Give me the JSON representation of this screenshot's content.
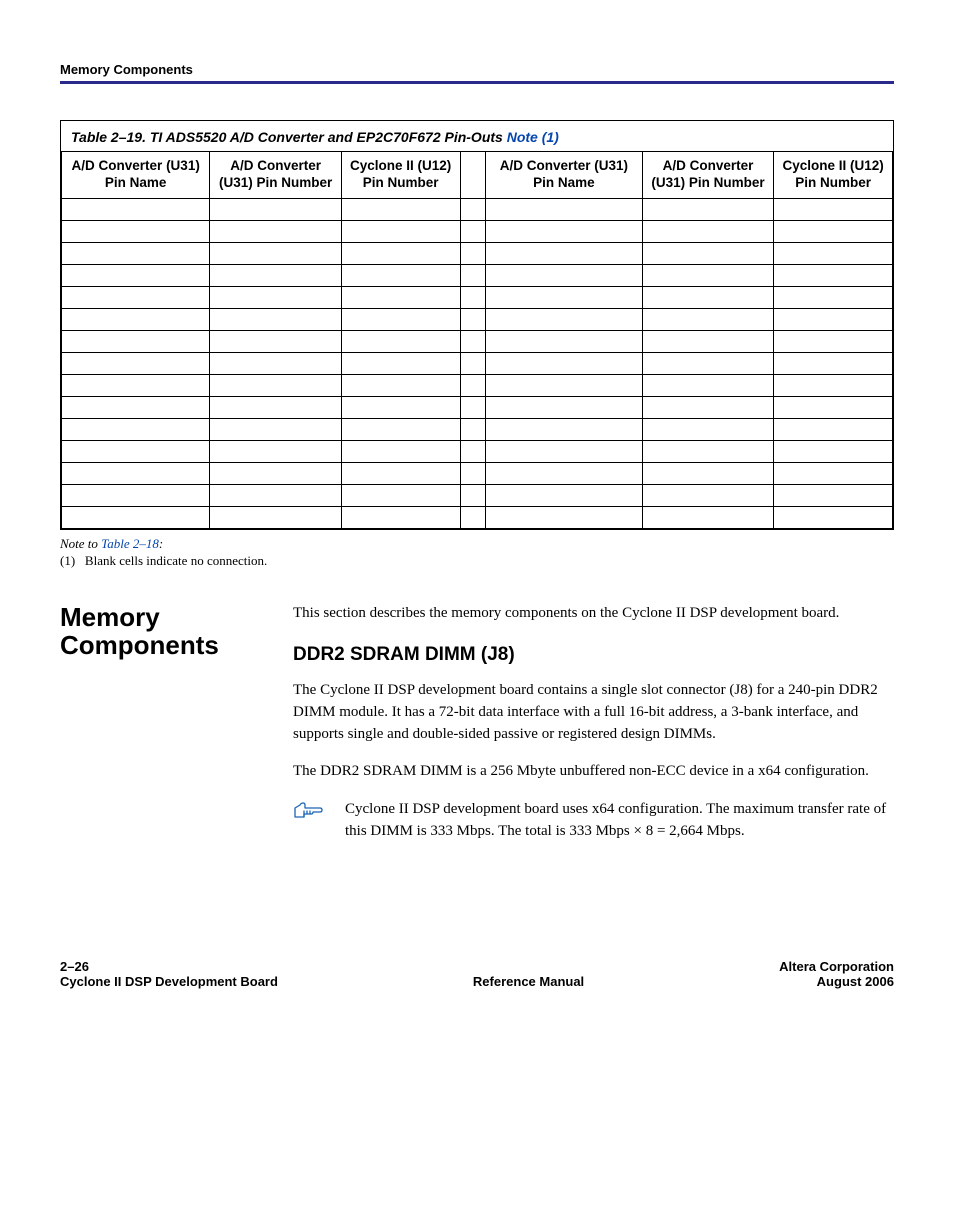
{
  "header": {
    "section": "Memory Components"
  },
  "table": {
    "caption_prefix": "Table 2–19. TI ADS5520 A/D Converter and EP2C70F672 Pin-Outs ",
    "caption_note": "Note (1)",
    "headers": {
      "c1": "A/D Converter (U31) Pin Name",
      "c2": "A/D Converter (U31) Pin Number",
      "c3": "Cyclone II (U12) Pin Number",
      "c4": "A/D Converter (U31) Pin Name",
      "c5": "A/D Converter (U31) Pin Number",
      "c6": "Cyclone II (U12) Pin Number"
    },
    "row_count": 15
  },
  "note": {
    "note_to": "Note to ",
    "ref": "Table 2–18",
    "colon": ":",
    "item_num": "(1)",
    "item_text": "Blank cells indicate no connection."
  },
  "section": {
    "side_heading": "Memory Components",
    "intro": "This section describes the memory components on the Cyclone II DSP development board.",
    "sub_heading": "DDR2 SDRAM DIMM (J8)",
    "p1": "The Cyclone II DSP development board contains a single slot connector (J8) for a 240-pin DDR2 DIMM module. It has a 72-bit data interface with a full 16-bit address, a 3-bank interface, and supports single and double-sided passive or registered design DIMMs.",
    "p2": "The DDR2 SDRAM DIMM is a 256 Mbyte unbuffered non-ECC device in a x64 configuration.",
    "hand_note": "Cyclone II DSP development board uses x64 configuration. The maximum transfer rate of this DIMM is 333 Mbps. The total is 333 Mbps × 8 = 2,664 Mbps."
  },
  "footer": {
    "left_line1": "2–26",
    "left_line2": "Cyclone II DSP Development Board",
    "center": "Reference Manual",
    "right_line1": "Altera Corporation",
    "right_line2": "August 2006"
  }
}
